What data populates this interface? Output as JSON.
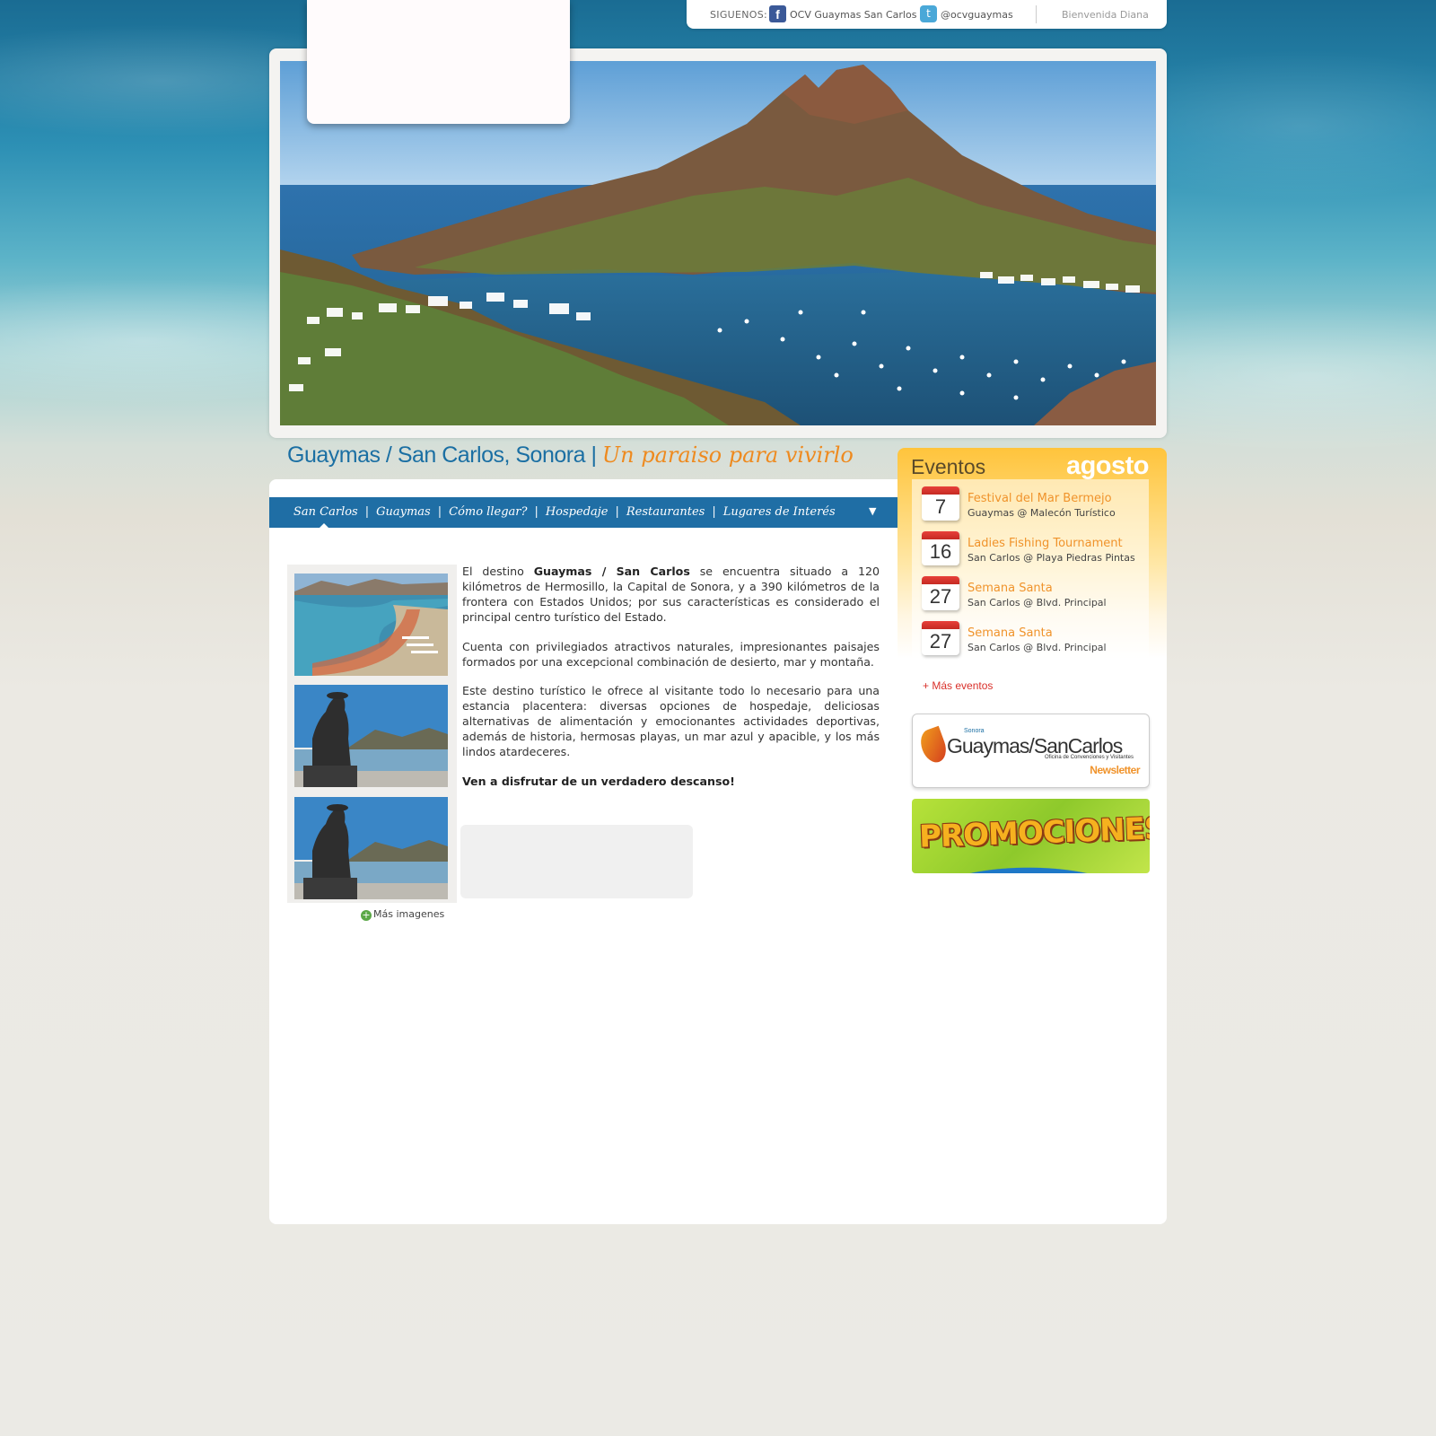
{
  "topbar": {
    "follow_label": "SIGUENOS:",
    "facebook_label": "OCV Guaymas San Carlos",
    "twitter_label": "@ocvguaymas",
    "welcome": "Bienvenida Diana"
  },
  "header": {
    "title": "Guaymas / San Carlos, Sonora |",
    "tagline": "Un paraiso para vivirlo"
  },
  "nav": {
    "items": [
      "San Carlos",
      "Guaymas",
      "Cómo llegar?",
      "Hospedaje",
      "Restaurantes",
      "Lugares de Interés"
    ],
    "separator": "|",
    "dropdown_arrow": "▼"
  },
  "content": {
    "p1_pre": "El destino ",
    "p1_bold": "Guaymas / San Carlos",
    "p1_post": " se encuentra situado a 120 kilómetros de Hermosillo, la Capital de Sonora, y  a 390 kilómetros de la frontera con Estados Unidos; por sus características es considerado el principal centro turístico del Estado.",
    "p2": "Cuenta con privilegiados atractivos naturales, impresionantes paisajes formados por una excepcional combinación de desierto, mar y montaña.",
    "p3": "Este destino turístico le ofrece al visitante todo lo necesario para una estancia placentera: diversas opciones de hospedaje, deliciosas alternativas de alimentación y emocionantes actividades deportivas, además de historia, hermosas playas, un mar azul y apacible, y  los más lindos atardeceres.",
    "p4": "Ven a disfrutar de un verdadero descanso!",
    "more_images": "Más imagenes"
  },
  "events": {
    "title": "Eventos",
    "month": "agosto",
    "items": [
      {
        "day": "7",
        "name": "Festival del Mar Bermejo",
        "place": "Guaymas @ Malecón Turístico"
      },
      {
        "day": "16",
        "name": "Ladies Fishing Tournament",
        "place": "San Carlos @ Playa Piedras Pintas"
      },
      {
        "day": "27",
        "name": "Semana Santa",
        "place": "San Carlos @ Blvd. Principal"
      },
      {
        "day": "27",
        "name": "Semana Santa",
        "place": "San Carlos @ Blvd. Principal"
      }
    ],
    "more_events": "+ Más eventos"
  },
  "newsletter": {
    "sonora": "Sonora",
    "brand": "Guaymas/SanCarlos",
    "subtitle": "Oficina de Convenciones y Visitantes",
    "label": "Newsletter"
  },
  "promo": {
    "label": "PROMOCIONES"
  },
  "icons": {
    "facebook": "facebook-icon",
    "twitter": "twitter-icon",
    "more_images": "plus-circle-icon",
    "calendar": "calendar-icon"
  },
  "colors": {
    "brand_blue": "#1f6ea5",
    "accent_orange": "#f0932b",
    "events_yellow": "#ffc43c",
    "more_events_red": "#d9302a"
  }
}
